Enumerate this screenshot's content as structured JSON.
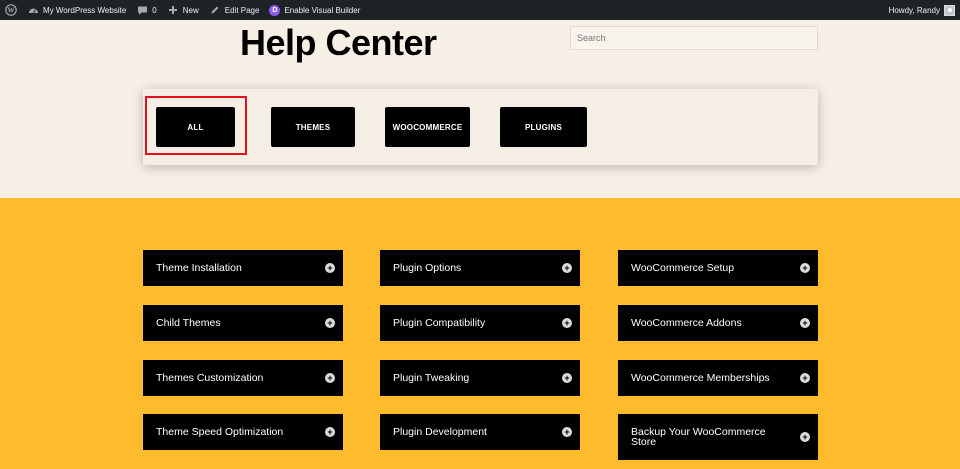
{
  "admin_bar": {
    "site_name": "My WordPress Website",
    "comments_count": "0",
    "new_label": "New",
    "edit_label": "Edit Page",
    "visual_builder_label": "Enable Visual Builder",
    "divi_letter": "D",
    "howdy_label": "Howdy, Randy",
    "icons": [
      "wordpress-icon",
      "dashboard-icon",
      "comment-icon",
      "plus-icon",
      "pencil-icon",
      "divi-icon",
      "avatar"
    ]
  },
  "header": {
    "title": "Help Center",
    "search_placeholder": "Search"
  },
  "filters": {
    "items": [
      "ALL",
      "THEMES",
      "WOOCOMMERCE",
      "PLUGINS"
    ],
    "selected": "ALL"
  },
  "topics": {
    "themes": [
      "Theme Installation",
      "Child Themes",
      "Themes Customization",
      "Theme Speed Optimization"
    ],
    "plugins": [
      "Plugin Options",
      "Plugin Compatibility",
      "Plugin Tweaking",
      "Plugin Development"
    ],
    "woocommerce": [
      "WooCommerce Setup",
      "WooCommerce Addons",
      "WooCommerce Memberships",
      "Backup Your WooCommerce Store"
    ],
    "expand_symbol": "+"
  },
  "colors": {
    "admin_bar": "#1d2327",
    "page_background": "#f6efe5",
    "section_yellow": "#fdbb2d",
    "button_black": "#000000",
    "highlight_red": "#e3101d"
  }
}
